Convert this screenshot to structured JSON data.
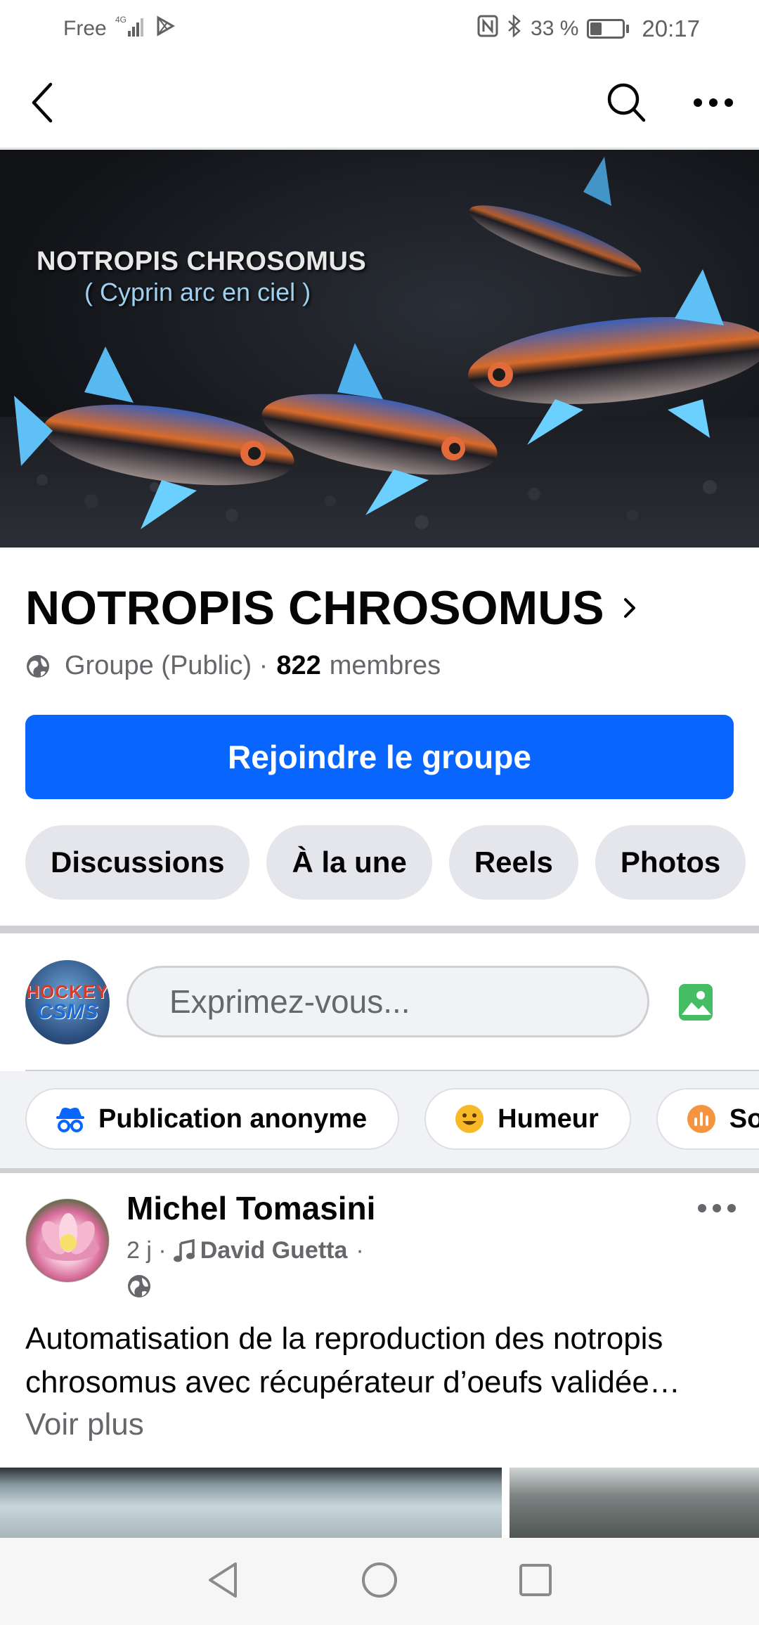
{
  "status_bar": {
    "carrier": "Free",
    "network": "4G",
    "battery": "33 %",
    "battery_level": 0.33,
    "time": "20:17"
  },
  "header": {
    "back_icon": "chevron-left-icon",
    "search_icon": "search-icon",
    "more_icon": "more-horizontal-icon"
  },
  "cover": {
    "title": "NOTROPIS CHROSOMUS",
    "subtitle": "( Cyprin arc en ciel )"
  },
  "group": {
    "name": "NOTROPIS CHROSOMUS",
    "privacy": "Groupe (Public) ·",
    "member_count": "822",
    "members_label": "membres",
    "join_label": "Rejoindre le groupe"
  },
  "tabs": [
    {
      "label": "Discussions"
    },
    {
      "label": "À la une"
    },
    {
      "label": "Reels"
    },
    {
      "label": "Photos"
    }
  ],
  "composer": {
    "avatar_text_1": "HOCKEY",
    "avatar_text_2": "CSMS",
    "placeholder": "Exprimez-vous..."
  },
  "chips": [
    {
      "label": "Publication anonyme",
      "icon": "incognito-icon"
    },
    {
      "label": "Humeur",
      "icon": "smiley-icon"
    },
    {
      "label": "So",
      "icon": "poll-icon"
    }
  ],
  "post": {
    "author": "Michel Tomasini",
    "time": "2 j ·",
    "music": "David Guetta",
    "music_sep": "·",
    "text": "Automatisation de la reproduction des notropis chrosomus avec récupérateur d’oeufs validée…",
    "see_more": "Voir plus"
  },
  "colors": {
    "accent": "#0866ff",
    "photo_green": "#45bd62",
    "emoji_yellow": "#f7b928",
    "poll_orange": "#f5943f"
  }
}
